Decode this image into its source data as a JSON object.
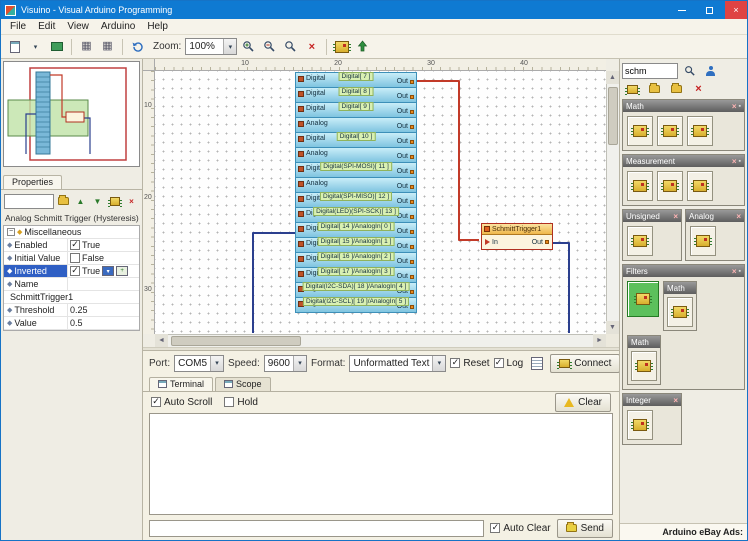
{
  "colors": {
    "titlebar_blue": "#0f7ad2",
    "pin_fill": "#a9dcf2",
    "pin_border": "#3d8fb8",
    "pin_name_bg": "#d9f0b2",
    "wire_red": "#c23a28",
    "wire_blue": "#2b3f8e",
    "component_header": "#efb74c",
    "selected_tile_green": "#5cc05c",
    "property_selected_blue": "#2f5fc4"
  },
  "titlebar": {
    "title": "Visuino - Visual Arduino Programming"
  },
  "menu": {
    "items": [
      {
        "label": "File"
      },
      {
        "label": "Edit"
      },
      {
        "label": "View"
      },
      {
        "label": "Arduino"
      },
      {
        "label": "Help"
      }
    ]
  },
  "toolbar": {
    "zoom_label": "Zoom:",
    "zoom_value": "100%"
  },
  "icons": {
    "dropdown": "▾",
    "close": "×",
    "grid": "▦",
    "minus": "−",
    "diamond": "◆",
    "sort_up": "▲",
    "sort_down": "▼",
    "scroll_up": "▲",
    "scroll_down": "▼",
    "scroll_left": "◄",
    "scroll_right": "►",
    "pin": "▪",
    "plus": "+"
  },
  "properties": {
    "tab_label": "Properties",
    "filter_value": "",
    "component_title": "Analog Schmitt Trigger (Hysteresis)",
    "rows": [
      {
        "label": "Miscellaneous",
        "group": true
      },
      {
        "label": "Enabled",
        "value": "True",
        "has_check": true,
        "checked": true
      },
      {
        "label": "Initial Value",
        "value": "False",
        "has_check": true,
        "checked": false
      },
      {
        "label": "Inverted",
        "value": "True",
        "has_check": true,
        "checked": true,
        "selected": true,
        "has_buttons": true
      },
      {
        "label": "Name",
        "value": ""
      },
      {
        "label": "SchmittTrigger1",
        "full": true
      },
      {
        "label": "Threshold",
        "value": "0.25"
      },
      {
        "label": "Value",
        "value": "0.5"
      }
    ]
  },
  "canvas": {
    "ruler_h": [
      {
        "n": "10"
      },
      {
        "n": "20"
      },
      {
        "n": "30"
      },
      {
        "n": "40"
      }
    ],
    "ruler_v": [
      {
        "n": "10"
      },
      {
        "n": "20"
      },
      {
        "n": "30"
      }
    ],
    "pins": [
      {
        "channel": "Digital",
        "name": "Digital[ 7 ]",
        "pin": "Out"
      },
      {
        "channel": "Digital",
        "name": "Digital[ 8 ]",
        "pin": "Out"
      },
      {
        "channel": "Digital",
        "name": "Digital[ 9 ]",
        "pin": "Out"
      },
      {
        "channel": "Analog",
        "name": "",
        "pin": "Out"
      },
      {
        "channel": "Digital",
        "name": "Digital[ 10 ]",
        "pin": "Out"
      },
      {
        "channel": "Analog",
        "name": "",
        "pin": "Out"
      },
      {
        "channel": "Digital",
        "name": "Digital(SPI-MOSI)[ 11 ]",
        "pin": "Out"
      },
      {
        "channel": "Analog",
        "name": "",
        "pin": "Out"
      },
      {
        "channel": "Digital",
        "name": "Digital(SPI-MISO)[ 12 ]",
        "pin": "Out"
      },
      {
        "channel": "Digital",
        "name": "Digital(LED)(SPI-SCK)[ 13 ]",
        "pin": "Out"
      },
      {
        "channel": "Digital",
        "name": "Digital[ 14 ]/AnalogIn[ 0 ]",
        "pin": "Out"
      },
      {
        "channel": "Digital",
        "name": "Digital[ 15 ]/AnalogIn[ 1 ]",
        "pin": "Out"
      },
      {
        "channel": "Digital",
        "name": "Digital[ 16 ]/AnalogIn[ 2 ]",
        "pin": "Out"
      },
      {
        "channel": "Digital",
        "name": "Digital[ 17 ]/AnalogIn[ 3 ]",
        "pin": "Out"
      },
      {
        "channel": "Digital",
        "name": "Digital(I2C-SDA)[ 18 ]/AnalogIn[ 4 ]",
        "pin": "Out"
      },
      {
        "channel": "Digital",
        "name": "Digital(I2C-SCL)[ 19 ]/AnalogIn[ 5 ]",
        "pin": "Out"
      }
    ],
    "component": {
      "title": "SchmittTrigger1",
      "in_label": "In",
      "out_label": "Out"
    }
  },
  "connection": {
    "port_label": "Port:",
    "port_value": "COM5",
    "speed_label": "Speed:",
    "speed_value": "9600",
    "format_label": "Format:",
    "format_value": "Unformatted Text",
    "reset_label": "Reset",
    "reset_checked": true,
    "log_label": "Log",
    "log_checked": true,
    "connect_label": "Connect"
  },
  "terminal": {
    "tabs": [
      {
        "label": "Terminal",
        "active": true
      },
      {
        "label": "Scope",
        "active": false
      }
    ],
    "autoscroll_label": "Auto Scroll",
    "autoscroll_checked": true,
    "hold_label": "Hold",
    "hold_checked": false,
    "clear_label": "Clear",
    "input_value": "",
    "autoclear_label": "Auto Clear",
    "autoclear_checked": true,
    "send_label": "Send"
  },
  "palette": {
    "search_value": "schm",
    "cat_math_top": {
      "name": "Math",
      "tiles": [
        {},
        {},
        {}
      ]
    },
    "cat_measurement": {
      "name": "Measurement",
      "tiles": [
        {},
        {},
        {}
      ]
    },
    "cat_unsigned": {
      "name": "Unsigned",
      "tiles": [
        {}
      ]
    },
    "cat_analog": {
      "name": "Analog",
      "tiles": [
        {}
      ]
    },
    "cat_filters": {
      "name": "Filters"
    },
    "cat_filters_math": {
      "name": "Math",
      "tiles": [
        {}
      ]
    },
    "cat_filters_math2": {
      "name": "Math",
      "tiles": [
        {}
      ]
    },
    "cat_integer": {
      "name": "Integer",
      "tiles": [
        {}
      ]
    },
    "ads_label": "Arduino eBay Ads:"
  }
}
